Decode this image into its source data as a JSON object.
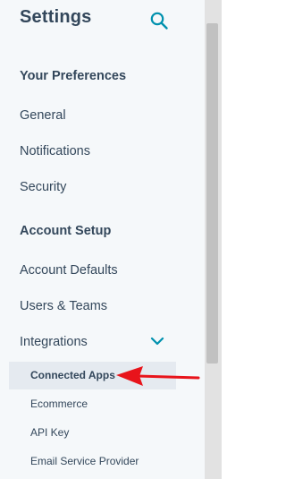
{
  "header": {
    "title": "Settings",
    "search_icon": "search-icon"
  },
  "sections": [
    {
      "heading": "Your Preferences",
      "items": [
        "General",
        "Notifications",
        "Security"
      ]
    },
    {
      "heading": "Account Setup",
      "items": [
        "Account Defaults",
        "Users & Teams",
        "Integrations"
      ]
    }
  ],
  "integrations": {
    "expanded": true,
    "chevron_icon": "chevron-down-icon",
    "sub_items": [
      "Connected Apps",
      "Ecommerce",
      "API Key",
      "Email Service Provider"
    ],
    "active_sub_item": "Connected Apps"
  },
  "annotation": {
    "arrow_color": "#e8141b",
    "points_to": "Connected Apps"
  },
  "colors": {
    "text": "#33475b",
    "accent": "#0091ae",
    "panel_bg": "#f5f8fa",
    "active_bg": "#e5eaf0"
  }
}
